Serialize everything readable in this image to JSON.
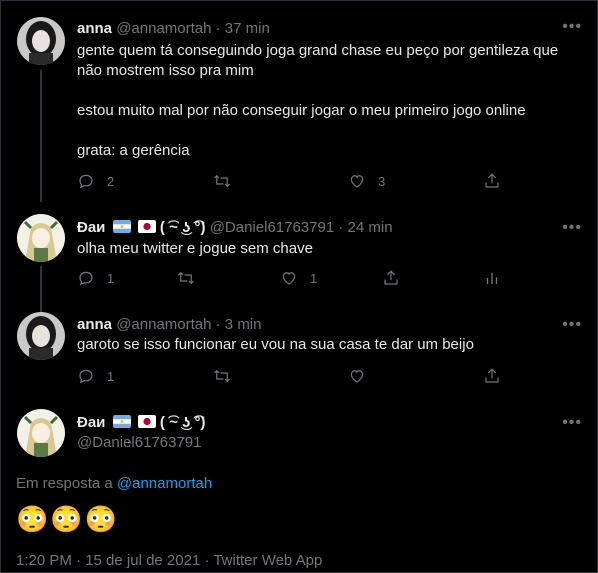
{
  "tweets": [
    {
      "name": "anna",
      "handle": "@annamortah",
      "time": "· 37 min",
      "text": "gente quem tá conseguindo joga grand chase eu peço por gentileza que\nnão mostrem isso pra mim\n\nestou muito mal por não conseguir jogar o meu primeiro jogo online\n\ngrata: a gerência",
      "replies": "2",
      "retweets": "",
      "likes": "3"
    },
    {
      "name": "Đаи",
      "emoticon": "( ͡~ ͜ʖ ͡°)",
      "handle": "@Daniel61763791",
      "time": "· 24 min",
      "text": "olha meu twitter e jogue sem chave",
      "replies": "1",
      "retweets": "",
      "likes": "1"
    },
    {
      "name": "anna",
      "handle": "@annamortah",
      "time": "· 3 min",
      "text": "garoto se isso funcionar eu vou na sua casa te dar um beijo",
      "replies": "1",
      "retweets": "",
      "likes": ""
    }
  ],
  "main": {
    "name": "Đаи",
    "emoticon": "( ͡~ ͜ʖ ͡°)",
    "handle": "@Daniel61763791",
    "reply_prefix": "Em resposta a",
    "reply_mention": "@annamortah",
    "emojis": "😳😳😳",
    "footer": "1:20 PM · 15 de jul de 2021 · Twitter Web App"
  },
  "icons": {
    "more": "more-dots-icon",
    "reply": "reply-icon",
    "retweet": "retweet-icon",
    "like": "like-icon",
    "share": "share-icon",
    "analytics": "analytics-icon"
  },
  "colors": {
    "background": "#000000",
    "text": "#e7e9ea",
    "muted": "#71767b",
    "link": "#1d9bf0"
  }
}
